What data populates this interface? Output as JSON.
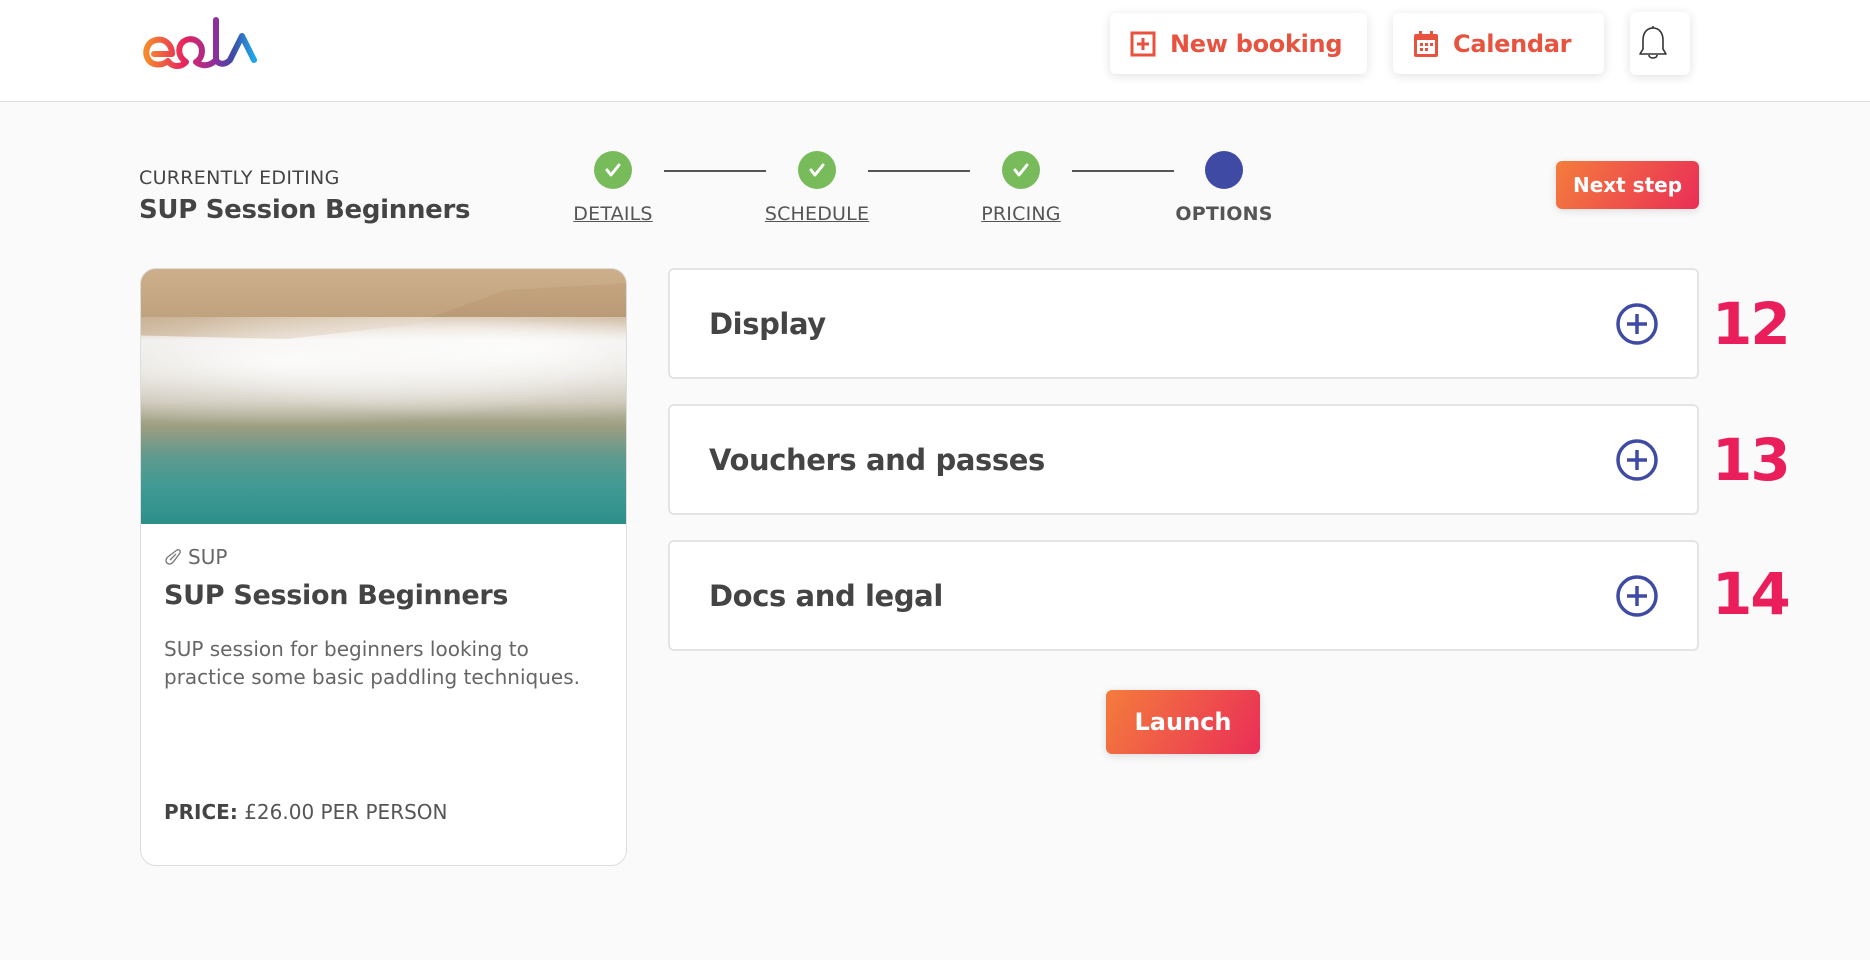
{
  "header": {
    "logo_text": "eola",
    "new_booking_label": "New booking",
    "calendar_label": "Calendar",
    "icons": {
      "new_booking": "plus-square-icon",
      "calendar": "calendar-icon",
      "notifications": "bell-icon"
    }
  },
  "editing": {
    "label": "CURRENTLY EDITING",
    "title": "SUP Session Beginners"
  },
  "stepper": {
    "steps": [
      {
        "label": "DETAILS",
        "status": "complete"
      },
      {
        "label": "SCHEDULE",
        "status": "complete"
      },
      {
        "label": "PRICING",
        "status": "complete"
      },
      {
        "label": "OPTIONS",
        "status": "current"
      }
    ]
  },
  "actions": {
    "next_step_label": "Next step",
    "launch_label": "Launch"
  },
  "preview_card": {
    "image_alt": "Aerial view of waves on a sandy beach",
    "category": "SUP",
    "category_icon": "paddle-icon",
    "title": "SUP Session Beginners",
    "description": "SUP session for beginners looking to practice some basic paddling techniques.",
    "price_label": "PRICE:",
    "price_value": "£26.00 PER PERSON"
  },
  "accordions": [
    {
      "title": "Display",
      "annotation": "12"
    },
    {
      "title": "Vouchers and passes",
      "annotation": "13"
    },
    {
      "title": "Docs and legal",
      "annotation": "14"
    }
  ],
  "colors": {
    "brand_orange": "#f47c3c",
    "brand_pink": "#ea2e57",
    "step_complete": "#78bb5a",
    "step_current": "#3e4aa3",
    "annotation": "#e91e5a",
    "header_button_text": "#e8533f"
  }
}
